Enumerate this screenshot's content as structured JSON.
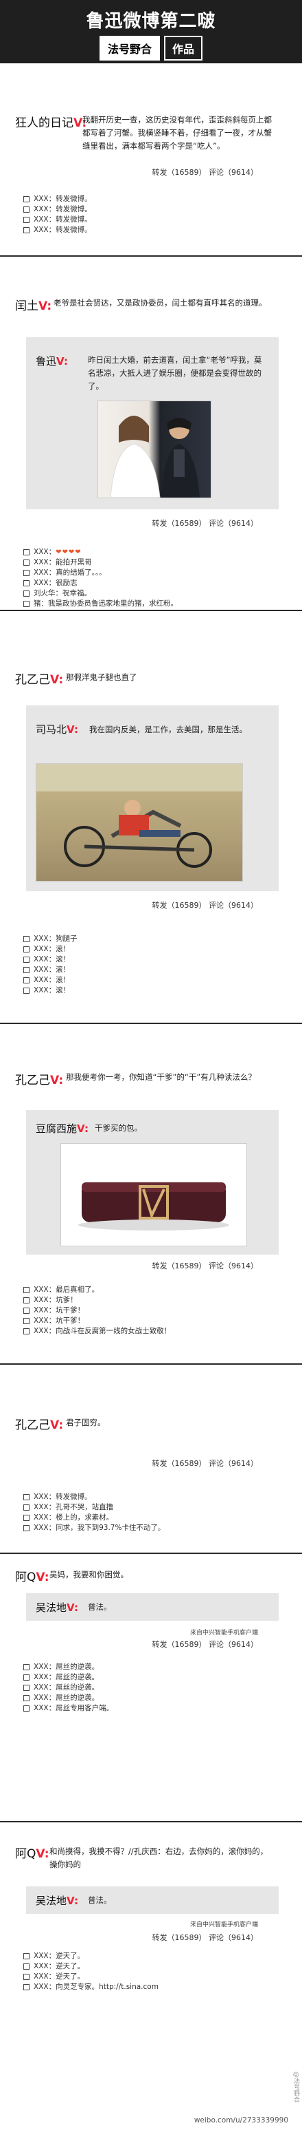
{
  "header": {
    "title": "鲁迅微博第二啵",
    "sub_a": "法号野合",
    "sub_b": "作品"
  },
  "post1": {
    "author": "狂人的日记",
    "v": "V:",
    "text": "我翻开历史一查，这历史没有年代，歪歪斜斜每页上都都写着了河蟹。我横竖睡不着，仔细看了一夜，才从蟹缝里看出，满本都写着两个字是“吃人”。",
    "stats": "转发（16589）  评论（9614）",
    "replies": [
      "XXX：转发微博。",
      "XXX：转发微博。",
      "XXX：转发微博。",
      "XXX：转发微博。"
    ]
  },
  "post2": {
    "author": "闰土",
    "v": "V:",
    "text": "老爷是社会贤达，又是政协委员，闰土都有直呼其名的道理。",
    "quote_author": "鲁迅",
    "quote_v": "V:",
    "quote_text": "昨日闰土大婚，前去道喜，闰土拿“老爷”呼我，莫名悲凉，大抵人进了娱乐圈，便都是会变得世故的了。",
    "stats": "转发（16589）  评论（9614）",
    "hearts": "❤❤❤❤",
    "replies": [
      "XXX：",
      "XXX：能拍开黑哥",
      "XXX：真的结婚了。。。",
      "XXX：很励志",
      "刘火华：祝幸福。",
      "猪：我是政协委员鲁迅家地里的猪，求红粉。"
    ]
  },
  "post3": {
    "author": "孔乙己",
    "v": "V:",
    "text": "那假洋鬼子腿也直了",
    "quote_author": "司马北",
    "quote_v": "V:",
    "quote_text": "我在国内反美，是工作，去美国，那是生活。",
    "stats": "转发（16589）  评论（9614）",
    "replies": [
      "XXX：狗腿子",
      "XXX：滚！",
      "XXX：滚！",
      "XXX：滚！",
      "XXX：滚！",
      "XXX：滚！"
    ]
  },
  "post4": {
    "author": "孔乙己",
    "v": "V:",
    "text": "那我便考你一考，你知道“干爹”的“干”有几种读法么？",
    "quote_author": "豆腐西施",
    "quote_v": "V:",
    "quote_text": "干爹买的包。",
    "stats": "转发（16589）  评论（9614）",
    "replies": [
      "XXX：最后真相了。",
      "XXX：坑爹！",
      "XXX：坑干爹！",
      "XXX：坑干爹！",
      "XXX：向战斗在反腐第一线的女战士致敬！"
    ]
  },
  "post5": {
    "author": "孔乙己",
    "v": "V:",
    "text": "君子固穷。",
    "stats": "转发（16589）  评论（9614）",
    "replies": [
      "XXX：转发微博。",
      "XXX：孔哥不哭，站直撸",
      "XXX：楼上的，求素材。",
      "XXX：同求，我下到93.7%卡住不动了。"
    ]
  },
  "post6": {
    "author": "阿Q",
    "v": "V:",
    "text": "吴妈，我要和你困觉。",
    "quote_author": "吴法地",
    "quote_v": "V:",
    "quote_text": "普法。",
    "source": "来自中兴智能手机客户端",
    "stats": "转发（16589）  评论（9614）",
    "replies": [
      "XXX：屌丝的逆袭。",
      "XXX：屌丝的逆袭。",
      "XXX：屌丝的逆袭。",
      "XXX：屌丝的逆袭。",
      "XXX：屌丝专用客户端。"
    ]
  },
  "post7": {
    "author": "阿Q",
    "v": "V:",
    "text": "和尚摸得，我摸不得？//孔庆西：右边，去你妈的，滚你妈的，操你妈的",
    "quote_author": "吴法地",
    "quote_v": "V:",
    "quote_text": "普法。",
    "source": "来自中兴智能手机客户端",
    "stats": "转发（16589）  评论（9614）",
    "replies": [
      "XXX：逆天了。",
      "XXX：逆天了。",
      "XXX：逆天了。",
      "XXX：向灵芝专家。http://t.sina.com"
    ]
  },
  "footer": {
    "url": "weibo.com/u/2733339990",
    "mark": "@法号野合"
  }
}
